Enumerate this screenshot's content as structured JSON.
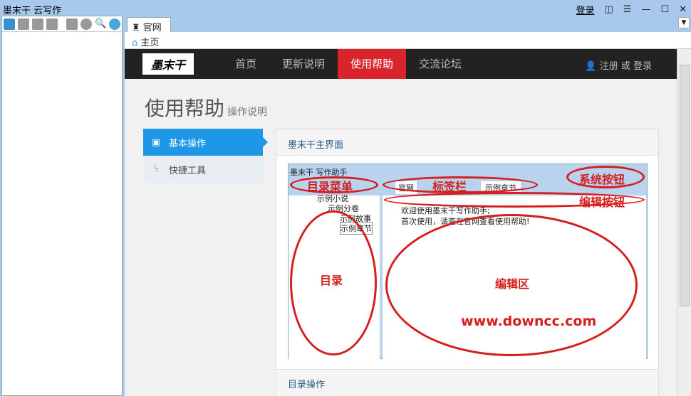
{
  "app": {
    "title": "墨末干 云写作",
    "login": "登录"
  },
  "tabs": [
    {
      "label": "官网"
    }
  ],
  "home": {
    "label": "主页"
  },
  "site": {
    "logo": "墨末干",
    "nav": [
      "首页",
      "更新说明",
      "使用帮助",
      "交流论坛"
    ],
    "user": "注册 或 登录",
    "page_title": "使用帮助",
    "page_subtitle": "操作说明",
    "side": [
      {
        "label": "基本操作"
      },
      {
        "label": "快捷工具"
      }
    ],
    "panel_title": "墨末干主界面",
    "panel2_title": "目录操作",
    "shot": {
      "title": "墨末干 写作助手",
      "tabs": [
        "官网",
        "标签栏",
        "示例章节"
      ],
      "tree": [
        "示例小说",
        "示例分卷",
        "示例故事",
        "示例章节"
      ],
      "lines": [
        "欢迎使用墨末干写作助手;",
        "首次使用，请查在官网查看使用帮助!"
      ],
      "annotations": {
        "menu": "目录菜单",
        "tabs": "标签栏",
        "sys": "系统按钮",
        "edit": "编辑按钮",
        "dir": "目录",
        "area": "编辑区"
      },
      "watermark": "www.downcc.com"
    }
  }
}
